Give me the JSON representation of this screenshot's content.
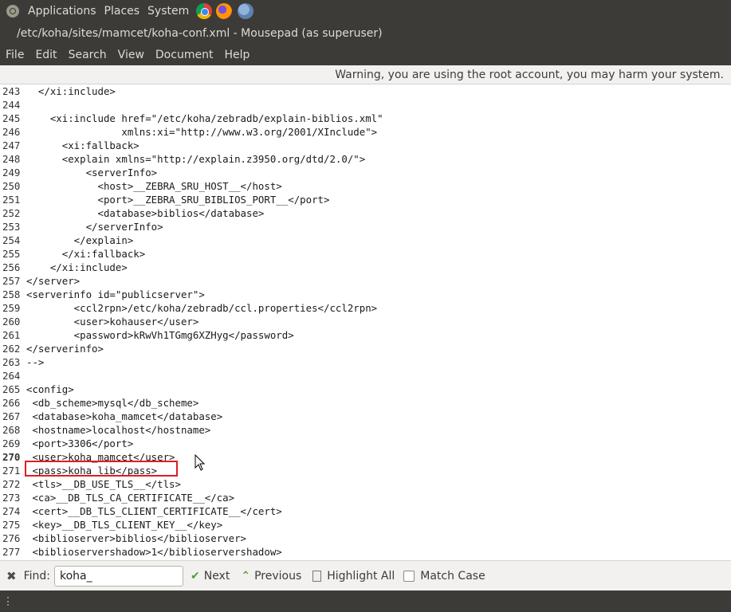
{
  "topbar": {
    "menus": [
      "Applications",
      "Places",
      "System"
    ],
    "launchers": [
      "chrome-icon",
      "firefox-icon",
      "globe-icon"
    ]
  },
  "window": {
    "title": "/etc/koha/sites/mamcet/koha-conf.xml - Mousepad (as superuser)"
  },
  "menubar": [
    "File",
    "Edit",
    "Search",
    "View",
    "Document",
    "Help"
  ],
  "warning": "Warning, you are using the root account, you may harm your system.",
  "editor": {
    "current_line": 270,
    "highlighted_line": 271,
    "lines": [
      {
        "n": "243",
        "t": "  </xi:include>"
      },
      {
        "n": "244",
        "t": ""
      },
      {
        "n": "245",
        "t": "    <xi:include href=\"/etc/koha/zebradb/explain-biblios.xml\""
      },
      {
        "n": "246",
        "t": "                xmlns:xi=\"http://www.w3.org/2001/XInclude\">"
      },
      {
        "n": "247",
        "t": "      <xi:fallback>"
      },
      {
        "n": "248",
        "t": "      <explain xmlns=\"http://explain.z3950.org/dtd/2.0/\">"
      },
      {
        "n": "249",
        "t": "          <serverInfo>"
      },
      {
        "n": "250",
        "t": "            <host>__ZEBRA_SRU_HOST__</host>"
      },
      {
        "n": "251",
        "t": "            <port>__ZEBRA_SRU_BIBLIOS_PORT__</port>"
      },
      {
        "n": "252",
        "t": "            <database>biblios</database>"
      },
      {
        "n": "253",
        "t": "          </serverInfo>"
      },
      {
        "n": "254",
        "t": "        </explain>"
      },
      {
        "n": "255",
        "t": "      </xi:fallback>"
      },
      {
        "n": "256",
        "t": "    </xi:include>"
      },
      {
        "n": "257",
        "t": "</server>"
      },
      {
        "n": "258",
        "t": "<serverinfo id=\"publicserver\">"
      },
      {
        "n": "259",
        "t": "        <ccl2rpn>/etc/koha/zebradb/ccl.properties</ccl2rpn>"
      },
      {
        "n": "260",
        "t": "        <user>kohauser</user>"
      },
      {
        "n": "261",
        "t": "        <password>kRwVh1TGmg6XZHyg</password>"
      },
      {
        "n": "262",
        "t": "</serverinfo>"
      },
      {
        "n": "263",
        "t": "-->"
      },
      {
        "n": "264",
        "t": ""
      },
      {
        "n": "265",
        "t": "<config>"
      },
      {
        "n": "266",
        "t": " <db_scheme>mysql</db_scheme>"
      },
      {
        "n": "267",
        "t": " <database>koha_mamcet</database>"
      },
      {
        "n": "268",
        "t": " <hostname>localhost</hostname>"
      },
      {
        "n": "269",
        "t": " <port>3306</port>"
      },
      {
        "n": "270",
        "t": " <user>koha_mamcet</user>"
      },
      {
        "n": "271",
        "t": " <pass>koha_lib</pass>"
      },
      {
        "n": "272",
        "t": " <tls>__DB_USE_TLS__</tls>"
      },
      {
        "n": "273",
        "t": " <ca>__DB_TLS_CA_CERTIFICATE__</ca>"
      },
      {
        "n": "274",
        "t": " <cert>__DB_TLS_CLIENT_CERTIFICATE__</cert>"
      },
      {
        "n": "275",
        "t": " <key>__DB_TLS_CLIENT_KEY__</key>"
      },
      {
        "n": "276",
        "t": " <biblioserver>biblios</biblioserver>"
      },
      {
        "n": "277",
        "t": " <biblioservershadow>1</biblioservershadow>"
      }
    ]
  },
  "findbar": {
    "find_label": "Find:",
    "find_value": "koha_",
    "next_label": "Next",
    "previous_label": "Previous",
    "highlight_label": "Highlight All",
    "match_case_label": "Match Case",
    "match_case_checked": false
  },
  "colors": {
    "panel": "#3c3b37",
    "highlight_box": "#e01d23"
  }
}
